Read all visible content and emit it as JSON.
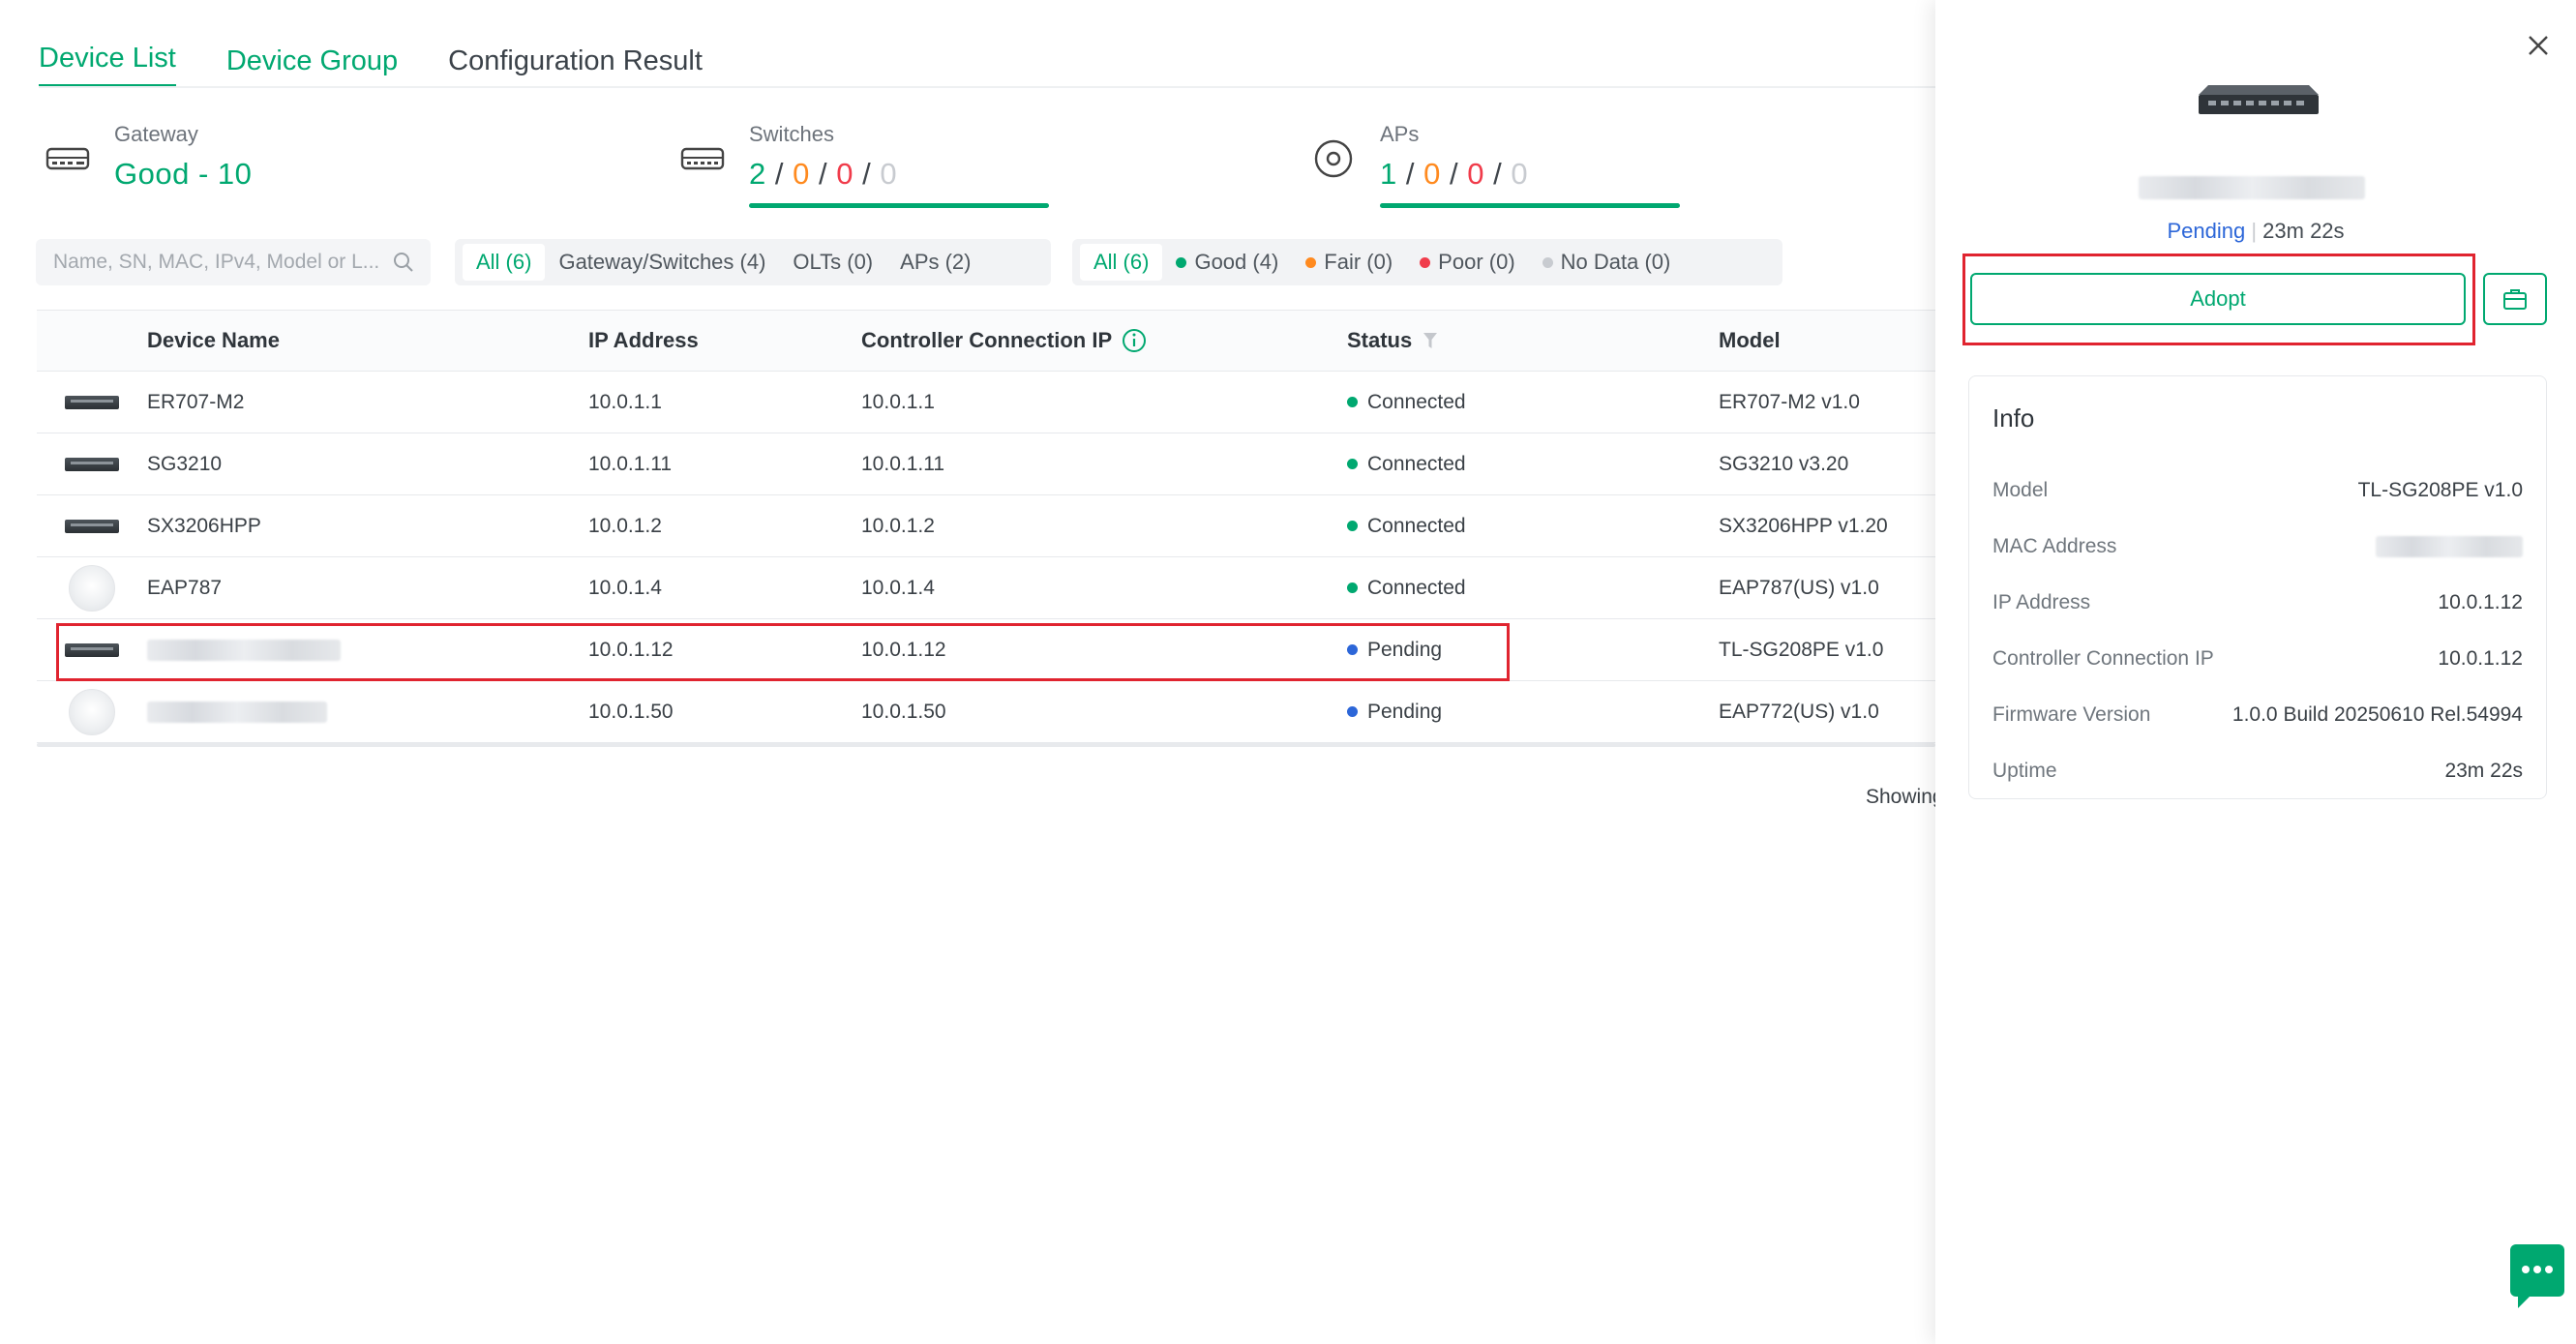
{
  "tabs": {
    "device_list": "Device List",
    "device_group": "Device Group",
    "config_result": "Configuration Result"
  },
  "summary": {
    "gateway": {
      "label": "Gateway",
      "value": "Good - 10"
    },
    "switches": {
      "label": "Switches",
      "good": "2",
      "fair": "0",
      "poor": "0",
      "nodata": "0"
    },
    "aps": {
      "label": "APs",
      "good": "1",
      "fair": "0",
      "poor": "0",
      "nodata": "0"
    },
    "sep": "/"
  },
  "search": {
    "placeholder": "Name, SN, MAC, IPv4, Model or L..."
  },
  "type_filters": [
    {
      "label": "All (6)",
      "active": true
    },
    {
      "label": "Gateway/Switches (4)"
    },
    {
      "label": "OLTs (0)"
    },
    {
      "label": "APs (2)"
    }
  ],
  "health_filters": [
    {
      "label": "All (6)",
      "active": true
    },
    {
      "label": "Good (4)",
      "color": "#00a870"
    },
    {
      "label": "Fair (0)",
      "color": "#ff8a1f"
    },
    {
      "label": "Poor (0)",
      "color": "#f03c4b"
    },
    {
      "label": "No Data (0)",
      "color": "#c8cbd0"
    }
  ],
  "table": {
    "headers": {
      "name": "Device Name",
      "ip": "IP Address",
      "cip": "Controller Connection IP",
      "status": "Status",
      "model": "Model"
    },
    "rows": [
      {
        "kind": "switch",
        "name": "ER707-M2",
        "ip": "10.0.1.1",
        "cip": "10.0.1.1",
        "status": "Connected",
        "model": "ER707-M2 v1.0"
      },
      {
        "kind": "switch",
        "name": "SG3210",
        "ip": "10.0.1.11",
        "cip": "10.0.1.11",
        "status": "Connected",
        "model": "SG3210 v3.20"
      },
      {
        "kind": "switch",
        "name": "SX3206HPP",
        "ip": "10.0.1.2",
        "cip": "10.0.1.2",
        "status": "Connected",
        "model": "SX3206HPP v1.20"
      },
      {
        "kind": "ap",
        "name": "EAP787",
        "ip": "10.0.1.4",
        "cip": "10.0.1.4",
        "status": "Connected",
        "model": "EAP787(US) v1.0"
      },
      {
        "kind": "switch",
        "name": "",
        "ip": "10.0.1.12",
        "cip": "10.0.1.12",
        "status": "Pending",
        "model": "TL-SG208PE v1.0"
      },
      {
        "kind": "ap",
        "name": "",
        "ip": "10.0.1.50",
        "cip": "10.0.1.50",
        "status": "Pending",
        "model": "EAP772(US) v1.0"
      }
    ]
  },
  "showing": "Showing",
  "panel": {
    "status": "Pending",
    "age": "23m 22s",
    "adopt": "Adopt",
    "info_title": "Info",
    "info": [
      {
        "k": "Model",
        "v": "TL-SG208PE v1.0"
      },
      {
        "k": "MAC Address",
        "v": ""
      },
      {
        "k": "IP Address",
        "v": "10.0.1.12"
      },
      {
        "k": "Controller Connection IP",
        "v": "10.0.1.12"
      },
      {
        "k": "Firmware Version",
        "v": "1.0.0 Build 20250610 Rel.54994"
      },
      {
        "k": "Uptime",
        "v": "23m 22s"
      }
    ]
  },
  "colors": {
    "brand": "#00a870",
    "pending": "#2c66d8",
    "annotation": "#e0242f"
  }
}
